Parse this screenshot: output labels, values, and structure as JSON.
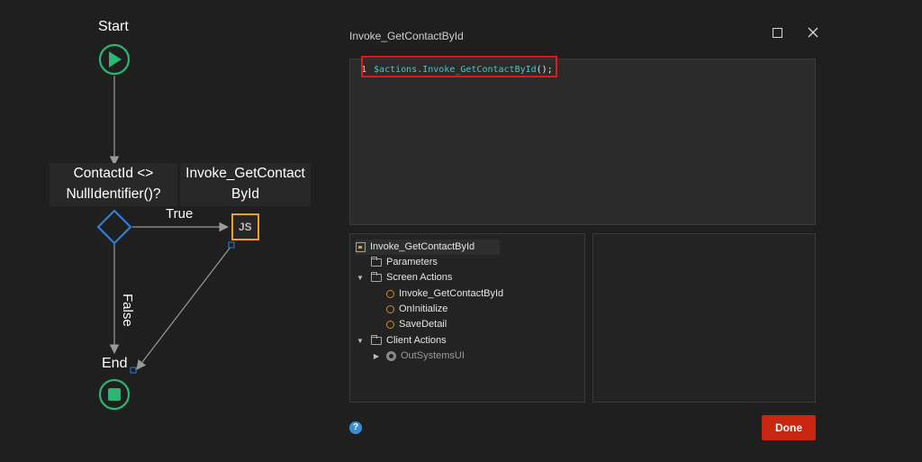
{
  "flow": {
    "start_label": "Start",
    "condition_label_line1": "ContactId <>",
    "condition_label_line2": "NullIdentifier()?",
    "js_node_label_line1": "Invoke_GetContact",
    "js_node_label_line2": "ById",
    "js_icon_text": "JS",
    "true_label": "True",
    "false_label": "False",
    "end_label": "End"
  },
  "dialog": {
    "title": "Invoke_GetContactById",
    "maximize_icon": "maximize-icon",
    "close_icon": "close-icon"
  },
  "editor": {
    "line_number": "1",
    "code": "$actions.Invoke_GetContactById",
    "code_suffix": "();"
  },
  "tree": {
    "root": "Invoke_GetContactById",
    "parameters": "Parameters",
    "screen_actions": "Screen Actions",
    "screen_action_items": [
      "Invoke_GetContactById",
      "OnInitialize",
      "SaveDetail"
    ],
    "client_actions": "Client Actions",
    "client_action_items": [
      "OutSystemsUI"
    ]
  },
  "footer": {
    "help_text": "?",
    "done_label": "Done"
  },
  "colors": {
    "start_green": "#2bb673",
    "decision_blue": "#2f7fd6",
    "js_orange": "#e8a21c",
    "highlight_red": "#e0191b",
    "done_red": "#c8260f"
  }
}
